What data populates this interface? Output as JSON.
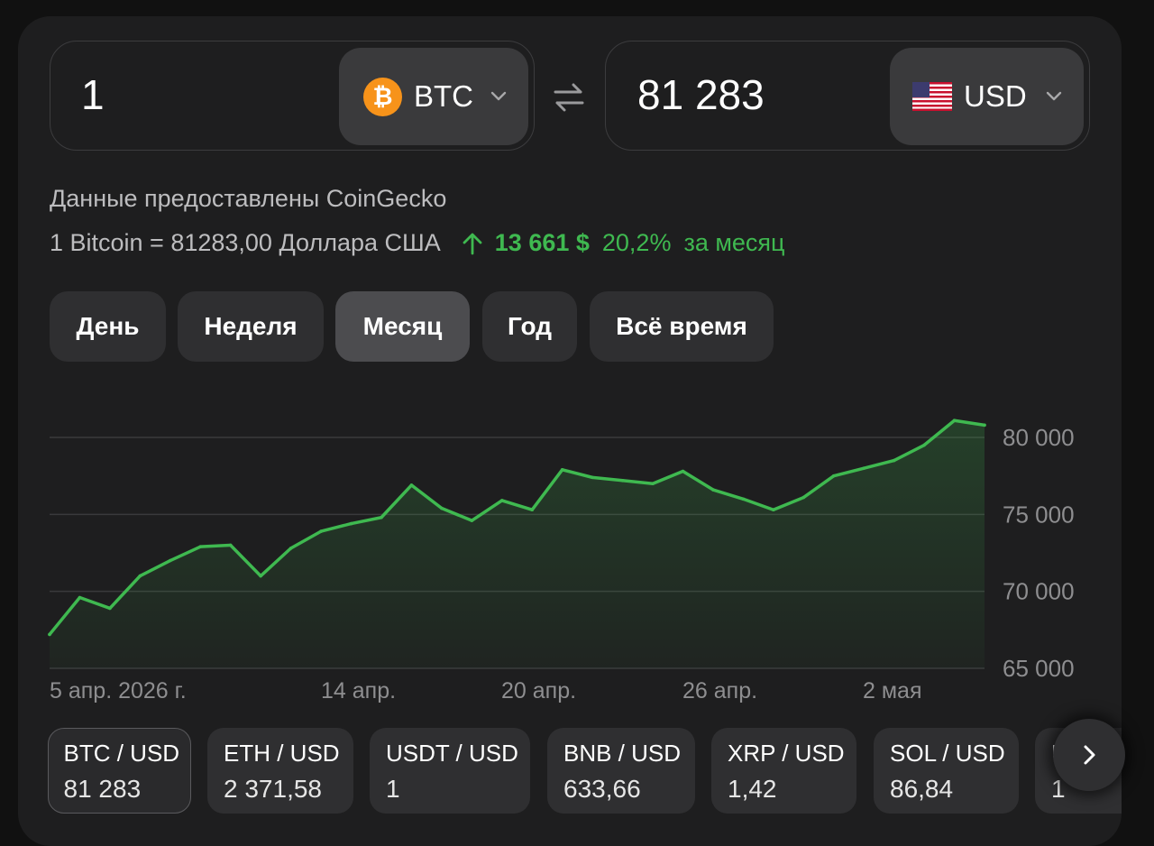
{
  "converter": {
    "from_amount": "1",
    "from_currency": "BTC",
    "to_amount": "81 283",
    "to_currency": "USD",
    "from_icon": "bitcoin-icon",
    "to_icon": "us-flag-icon",
    "swap_icon": "swap-arrows-icon"
  },
  "source_text": "Данные предоставлены CoinGecko",
  "rate": {
    "text": "1 Bitcoin = 81283,00 Доллара США",
    "change_abs": "13 661 $",
    "change_pct": "20,2%",
    "period": "за месяц",
    "trend_icon": "arrow-up-icon",
    "color": "#3fb950"
  },
  "periods": [
    {
      "label": "День",
      "active": false
    },
    {
      "label": "Неделя",
      "active": false
    },
    {
      "label": "Месяц",
      "active": true
    },
    {
      "label": "Год",
      "active": false
    },
    {
      "label": "Всё время",
      "active": false
    }
  ],
  "chart_data": {
    "type": "area",
    "series": [
      {
        "values": [
          67200,
          69600,
          68900,
          71000,
          72000,
          72900,
          73000,
          71000,
          72800,
          73900,
          74400,
          74800,
          76900,
          75400,
          74600,
          75900,
          75300,
          77900,
          77400,
          77200,
          77000,
          77800,
          76600,
          76000,
          75300,
          76100,
          77500,
          78000,
          78500,
          79500,
          81100,
          80800
        ]
      }
    ],
    "yticks": [
      "80 000",
      "75 000",
      "70 000",
      "65 000"
    ],
    "ytick_values": [
      80000,
      75000,
      70000,
      65000
    ],
    "ylim": [
      65000,
      80000
    ],
    "xticks": [
      "5 апр. 2026 г.",
      "14 апр.",
      "20 апр.",
      "26 апр.",
      "2 мая"
    ],
    "grid": true,
    "line_color": "#3fb950"
  },
  "pairs": [
    {
      "name": "BTC / USD",
      "value": "81 283",
      "active": true
    },
    {
      "name": "ETH / USD",
      "value": "2 371,58",
      "active": false
    },
    {
      "name": "USDT / USD",
      "value": "1",
      "active": false
    },
    {
      "name": "BNB / USD",
      "value": "633,66",
      "active": false
    },
    {
      "name": "XRP / USD",
      "value": "1,42",
      "active": false
    },
    {
      "name": "SOL / USD",
      "value": "86,84",
      "active": false
    },
    {
      "name": "US",
      "value": "1",
      "active": false
    }
  ],
  "next_icon": "chevron-right-icon"
}
